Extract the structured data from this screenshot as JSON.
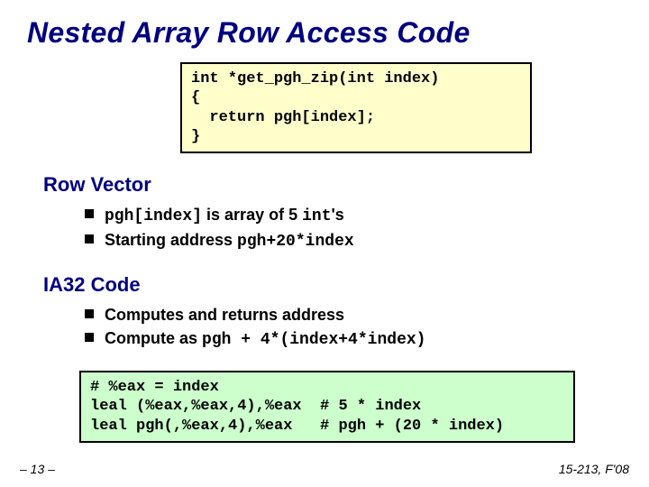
{
  "title": "Nested Array Row Access Code",
  "code_top": "int *get_pgh_zip(int index)\n{\n  return pgh[index];\n}",
  "section1": {
    "heading": "Row Vector",
    "bullets": [
      {
        "pre": "",
        "code1": "pgh[index]",
        "mid": " is array of 5 ",
        "code2": "int",
        "post": "'s"
      },
      {
        "pre": "Starting address ",
        "code1": "pgh+20*index",
        "mid": "",
        "code2": "",
        "post": ""
      }
    ]
  },
  "section2": {
    "heading": "IA32 Code",
    "bullets": [
      {
        "pre": "Computes and returns address",
        "code1": "",
        "mid": "",
        "code2": "",
        "post": ""
      },
      {
        "pre": "Compute as ",
        "code1": "pgh + 4*(index+4*index)",
        "mid": "",
        "code2": "",
        "post": ""
      }
    ]
  },
  "code_bottom": "# %eax = index\nleal (%eax,%eax,4),%eax  # 5 * index\nleal pgh(,%eax,4),%eax   # pgh + (20 * index)",
  "slide_number": "– 13 –",
  "course": "15-213, F'08"
}
